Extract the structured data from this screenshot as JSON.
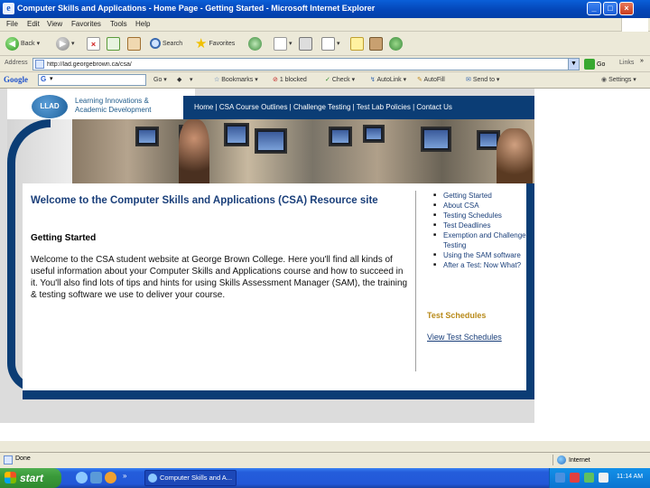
{
  "window": {
    "title": "Computer Skills and Applications - Home Page - Getting Started - Microsoft Internet Explorer",
    "minimize": "_",
    "maximize": "□",
    "close": "×"
  },
  "menu": [
    "File",
    "Edit",
    "View",
    "Favorites",
    "Tools",
    "Help"
  ],
  "toolbar": {
    "back": "Back",
    "search": "Search",
    "favorites": "Favorites"
  },
  "address": {
    "label": "Address",
    "url": "http://lad.georgebrown.ca/csa/",
    "go": "Go",
    "links": "Links"
  },
  "google_bar": {
    "logo": "Google",
    "go": "Go",
    "bookmarks": "Bookmarks",
    "blocked": "1 blocked",
    "check": "Check",
    "autolink": "AutoLink",
    "autofill": "AutoFill",
    "send_to": "Send to",
    "settings": "Settings"
  },
  "site": {
    "logo_abbr": "LLAD",
    "logo_line1": "Learning Innovations &",
    "logo_line2": "Academic Development",
    "nav": "Home | CSA Course Outlines | Challenge Testing | Test Lab Policies | Contact Us",
    "welcome": "Welcome to the Computer Skills and Applications (CSA) Resource site",
    "section_title": "Getting Started",
    "paragraph": "Welcome to the CSA student website at George Brown College. Here you'll find all kinds of useful information about your Computer Skills and Applications course and how to succeed in it. You'll also find lots of tips and hints for using Skills Assessment Manager (SAM), the training & testing software we use to deliver your course.",
    "side_links": [
      "Getting Started",
      "About CSA",
      "Testing Schedules",
      "Test Deadlines",
      "Exemption and Challenge Testing",
      "Using the SAM software",
      "After a Test: Now What?"
    ],
    "side_heading": "Test Schedules",
    "side_link": "View Test Schedules"
  },
  "status": {
    "text": "Done",
    "zone": "Internet"
  },
  "taskbar": {
    "start": "start",
    "task": "Computer Skills and A...",
    "clock": "11:14 AM"
  },
  "colors": {
    "navy": "#0b3d75",
    "heading_blue": "#1a3f7a",
    "gold": "#b88a1a",
    "xp_blue": "#245ddb",
    "start_green": "#3a9a3a"
  }
}
